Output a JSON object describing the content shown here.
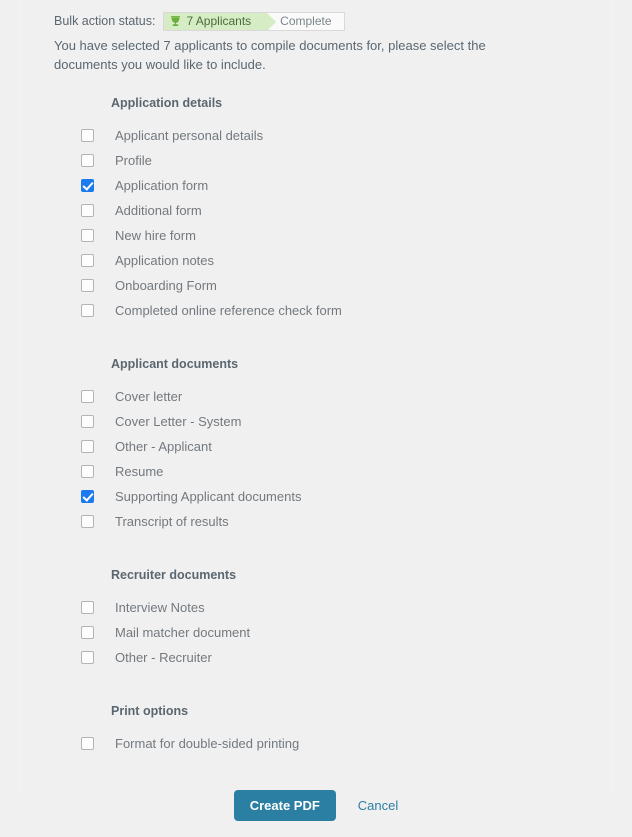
{
  "status": {
    "label": "Bulk action status:",
    "steps": [
      {
        "text": "7 Applicants",
        "state": "active",
        "icon": "trophy-icon"
      },
      {
        "text": "Complete",
        "state": "done"
      }
    ]
  },
  "intro": "You have selected 7 applicants to compile documents for, please select the documents you would like to include.",
  "sections": [
    {
      "title": "Application details",
      "options": [
        {
          "label": "Applicant personal details",
          "checked": false
        },
        {
          "label": "Profile",
          "checked": false
        },
        {
          "label": "Application form",
          "checked": true
        },
        {
          "label": "Additional form",
          "checked": false
        },
        {
          "label": "New hire form",
          "checked": false
        },
        {
          "label": "Application notes",
          "checked": false
        },
        {
          "label": "Onboarding Form",
          "checked": false
        },
        {
          "label": "Completed online reference check form",
          "checked": false
        }
      ]
    },
    {
      "title": "Applicant documents",
      "options": [
        {
          "label": "Cover letter",
          "checked": false
        },
        {
          "label": "Cover Letter - System",
          "checked": false
        },
        {
          "label": "Other - Applicant",
          "checked": false
        },
        {
          "label": "Resume",
          "checked": false
        },
        {
          "label": "Supporting Applicant documents",
          "checked": true
        },
        {
          "label": "Transcript of results",
          "checked": false
        }
      ]
    },
    {
      "title": "Recruiter documents",
      "options": [
        {
          "label": "Interview Notes",
          "checked": false
        },
        {
          "label": "Mail matcher document",
          "checked": false
        },
        {
          "label": "Other - Recruiter",
          "checked": false
        }
      ]
    },
    {
      "title": "Print options",
      "options": [
        {
          "label": "Format for double-sided printing",
          "checked": false
        }
      ]
    }
  ],
  "footer": {
    "primary_label": "Create PDF",
    "cancel_label": "Cancel"
  },
  "colors": {
    "page_background": "#f0f0f0",
    "primary_button": "#2b7fa3",
    "link": "#2b7fa3",
    "checkbox_checked": "#1a7aee",
    "breadcrumb_active": "#d6ecc4",
    "text": "#5b6770"
  }
}
